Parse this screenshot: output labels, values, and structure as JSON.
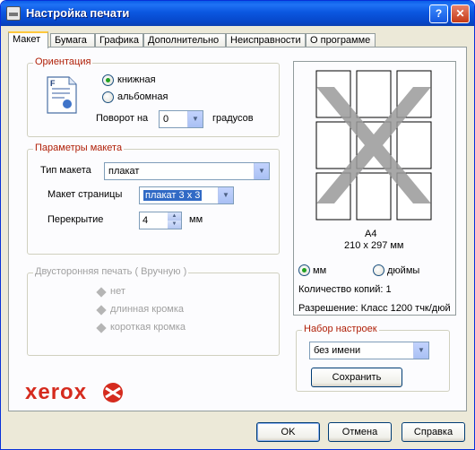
{
  "window": {
    "title": "Настройка печати",
    "help_button": "?",
    "close_button": "✕"
  },
  "tabs": [
    "Макет",
    "Бумага",
    "Графика",
    "Дополнительно",
    "Неисправности",
    "О программе"
  ],
  "orientation": {
    "label": "Ориентация",
    "portrait": "книжная",
    "landscape": "альбомная",
    "selected": "portrait",
    "rotate_label": "Поворот на",
    "rotate_value": "0",
    "degrees_label": "градусов"
  },
  "layout": {
    "label": "Параметры макета",
    "type_label": "Тип макета",
    "type_value": "плакат",
    "page_layout_label": "Макет страницы",
    "page_layout_value": "плакат 3 x 3",
    "overlap_label": "Перекрытие",
    "overlap_value": "4",
    "overlap_unit": "мм"
  },
  "duplex": {
    "label": "Двусторонняя печать ( Вручную )",
    "none": "нет",
    "long_edge": "длинная кромка",
    "short_edge": "короткая кромка"
  },
  "preview": {
    "paper": "A4",
    "size": "210 x 297 мм",
    "unit_mm": "мм",
    "unit_inch": "дюймы",
    "selected_unit": "mm",
    "copies": "Количество копий: 1",
    "resolution": "Разрешение: Класс 1200 тчк/дюйм"
  },
  "presets": {
    "label": "Набор настроек",
    "value": "без имени",
    "save_label": "Сохранить"
  },
  "brand": {
    "logo_text": "xerox",
    "logo_color": "#d52b1e"
  },
  "footer": {
    "ok": "OK",
    "cancel": "Отмена",
    "help": "Справка"
  }
}
